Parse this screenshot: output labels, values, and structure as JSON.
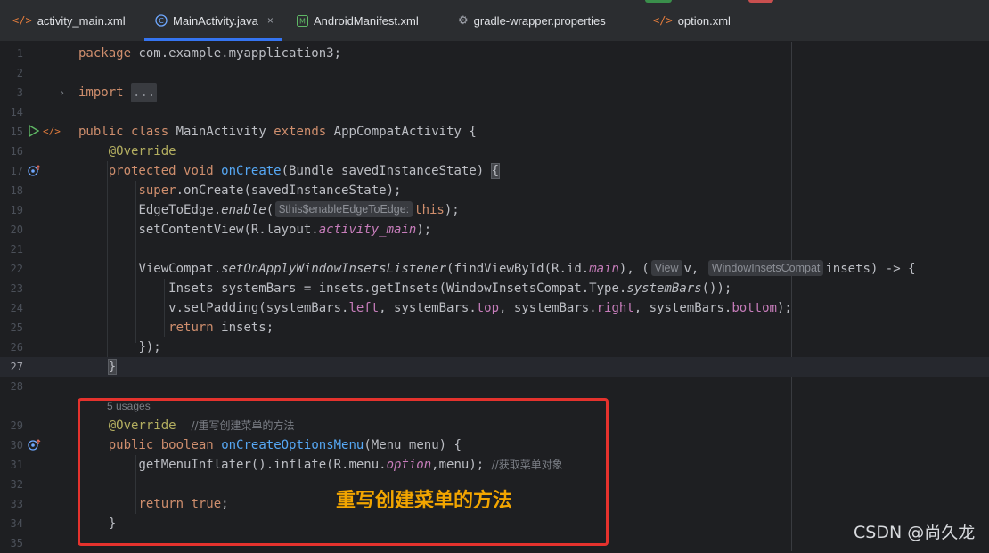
{
  "tabs": [
    {
      "label": "activity_main.xml",
      "icon": "xml-code-icon"
    },
    {
      "label": "MainActivity.java",
      "icon": "class-c-icon",
      "active": true,
      "close": "×"
    },
    {
      "label": "AndroidManifest.xml",
      "icon": "manifest-icon"
    },
    {
      "label": "gradle-wrapper.properties",
      "icon": "gear-icon"
    },
    {
      "label": "option.xml",
      "icon": "xml-code-icon"
    }
  ],
  "line_numbers": [
    "1",
    "2",
    "3",
    "14",
    "15",
    "16",
    "17",
    "18",
    "19",
    "20",
    "21",
    "22",
    "23",
    "24",
    "25",
    "26",
    "27",
    "28",
    "29",
    "30",
    "31",
    "32",
    "33",
    "34",
    "35"
  ],
  "code": {
    "l1_kw": "package",
    "l1_rest": " com.example.myapplication3;",
    "l3_kw": "import",
    "l3_fold": "...",
    "l15_kw1": "public",
    "l15_kw2": "class",
    "l15_name": "MainActivity",
    "l15_kw3": "extends",
    "l15_rest": "AppCompatActivity {",
    "l16_ann": "@Override",
    "l17_kw1": "protected",
    "l17_kw2": "void",
    "l17_fn": "onCreate",
    "l17_rest": "(Bundle savedInstanceState) ",
    "l17_brace": "{",
    "l18_kw": "super",
    "l18_rest": ".onCreate(savedInstanceState);",
    "l19_a": "EdgeToEdge.",
    "l19_it": "enable",
    "l19_b": "(",
    "l19_hint": "$this$enableEdgeToEdge:",
    "l19_kw": "this",
    "l19_c": ");",
    "l20_a": "setContentView(R.layout.",
    "l20_fld": "activity_main",
    "l20_b": ");",
    "l22_a": "ViewCompat.",
    "l22_it": "setOnApplyWindowInsetsListener",
    "l22_b": "(findViewById(R.id.",
    "l22_fld": "main",
    "l22_c": "), (",
    "l22_hint1": "View",
    "l22_d": "v,",
    "l22_hint2": "WindowInsetsCompat",
    "l22_e": "insets) -> {",
    "l23_a": "Insets systemBars = insets.getInsets(WindowInsetsCompat.Type.",
    "l23_it": "systemBars",
    "l23_b": "());",
    "l24_a": "v.setPadding(systemBars.",
    "l24_f1": "left",
    "l24_s1": ", systemBars.",
    "l24_f2": "top",
    "l24_s2": ", systemBars.",
    "l24_f3": "right",
    "l24_s3": ", systemBars.",
    "l24_f4": "bottom",
    "l24_b": ");",
    "l25_kw": "return",
    "l25_rest": " insets;",
    "l26": "});",
    "l27": "}",
    "usages": "5 usages",
    "l29_ann": "@Override",
    "l29_cm": "//重写创建菜单的方法",
    "l30_kw1": "public",
    "l30_kw2": "boolean",
    "l30_fn": "onCreateOptionsMenu",
    "l30_rest": "(Menu menu) {",
    "l31_a": "getMenuInflater().inflate(R.menu.",
    "l31_fld": "option",
    "l31_b": ",menu); ",
    "l31_cm": "//获取菜单对象",
    "l33_kw1": "return",
    "l33_kw2": "true",
    "l33_rest": ";",
    "l34": "}"
  },
  "annotation_label": "重写创建菜单的方法",
  "watermark": "CSDN @尚久龙",
  "colors": {
    "accent": "#3574f0",
    "highlight_box": "#e5322d",
    "callout_text": "#f2a500"
  }
}
